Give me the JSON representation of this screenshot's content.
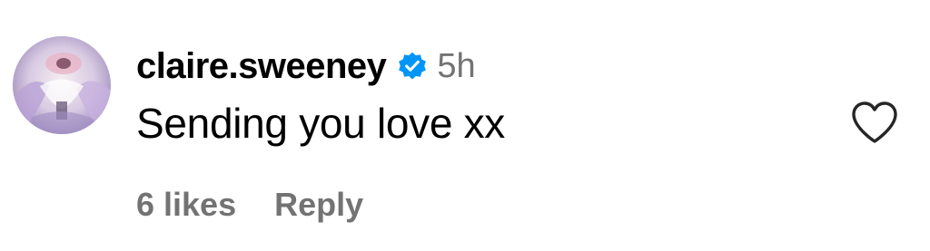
{
  "comment": {
    "username": "claire.sweeney",
    "verified": true,
    "timestamp": "5h",
    "text": "Sending you love xx",
    "likes_label": "6 likes",
    "reply_label": "Reply"
  },
  "icons": {
    "verified": "verified-badge-icon",
    "like": "heart-outline-icon"
  },
  "colors": {
    "text_primary": "#000000",
    "text_secondary": "#737373",
    "verified_blue": "#0095f6"
  }
}
